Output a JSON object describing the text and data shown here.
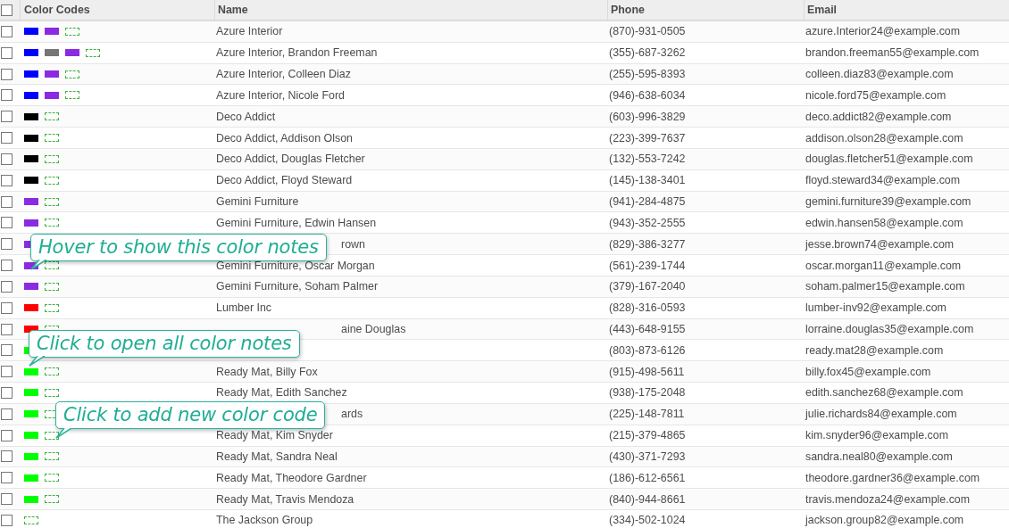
{
  "header": {
    "checked": false,
    "columns": [
      "Color Codes",
      "Name",
      "Phone",
      "Email"
    ]
  },
  "rows": [
    {
      "checked": false,
      "colors": [
        {
          "color": "#0000ff"
        },
        {
          "color": "#8a2be2"
        }
      ],
      "name": "Azure Interior",
      "phone": "(870)-931-0505",
      "email": "azure.Interior24@example.com"
    },
    {
      "checked": false,
      "colors": [
        {
          "color": "#0000ff"
        },
        {
          "color": "#757575"
        },
        {
          "color": "#8a2be2"
        }
      ],
      "name": "Azure Interior, Brandon Freeman",
      "phone": "(355)-687-3262",
      "email": "brandon.freeman55@example.com"
    },
    {
      "checked": false,
      "colors": [
        {
          "color": "#0000ff"
        },
        {
          "color": "#8a2be2"
        }
      ],
      "name": "Azure Interior, Colleen Diaz",
      "phone": "(255)-595-8393",
      "email": "colleen.diaz83@example.com"
    },
    {
      "checked": false,
      "colors": [
        {
          "color": "#0000ff"
        },
        {
          "color": "#8a2be2"
        }
      ],
      "name": "Azure Interior, Nicole Ford",
      "phone": "(946)-638-6034",
      "email": "nicole.ford75@example.com"
    },
    {
      "checked": false,
      "colors": [
        {
          "color": "#000000"
        }
      ],
      "name": "Deco Addict",
      "phone": "(603)-996-3829",
      "email": "deco.addict82@example.com"
    },
    {
      "checked": false,
      "colors": [
        {
          "color": "#000000"
        }
      ],
      "name": "Deco Addict, Addison Olson",
      "phone": "(223)-399-7637",
      "email": "addison.olson28@example.com"
    },
    {
      "checked": false,
      "colors": [
        {
          "color": "#000000"
        }
      ],
      "name": "Deco Addict, Douglas Fletcher",
      "phone": "(132)-553-7242",
      "email": "douglas.fletcher51@example.com"
    },
    {
      "checked": false,
      "colors": [
        {
          "color": "#000000"
        }
      ],
      "name": "Deco Addict, Floyd Steward",
      "phone": "(145)-138-3401",
      "email": "floyd.steward34@example.com"
    },
    {
      "checked": false,
      "colors": [
        {
          "color": "#8a2be2"
        }
      ],
      "name": "Gemini Furniture",
      "phone": "(941)-284-4875",
      "email": "gemini.furniture39@example.com"
    },
    {
      "checked": false,
      "colors": [
        {
          "color": "#8a2be2"
        }
      ],
      "name": "Gemini Furniture, Edwin Hansen",
      "phone": "(943)-352-2555",
      "email": "edwin.hansen58@example.com"
    },
    {
      "checked": false,
      "colors": [
        {
          "color": "#8a2be2"
        }
      ],
      "name": "rown",
      "name_cut": true,
      "add_covered": true,
      "phone": "(829)-386-3277",
      "email": "jesse.brown74@example.com"
    },
    {
      "checked": false,
      "colors": [
        {
          "color": "#8a2be2"
        }
      ],
      "name": "Gemini Furniture, Oscar Morgan",
      "phone": "(561)-239-1744",
      "email": "oscar.morgan11@example.com",
      "callout": {
        "kind": "hover",
        "text": "Hover to show this color notes"
      }
    },
    {
      "checked": false,
      "colors": [
        {
          "color": "#8a2be2"
        }
      ],
      "name": "Gemini Furniture, Soham Palmer",
      "phone": "(379)-167-2040",
      "email": "soham.palmer15@example.com"
    },
    {
      "checked": false,
      "colors": [
        {
          "color": "#ff0000"
        }
      ],
      "name": "Lumber Inc",
      "phone": "(828)-316-0593",
      "email": "lumber-inv92@example.com"
    },
    {
      "checked": false,
      "colors": [
        {
          "color": "#ff0000"
        }
      ],
      "name": "aine Douglas",
      "name_cut": true,
      "phone": "(443)-648-9155",
      "email": "lorraine.douglas35@example.com"
    },
    {
      "checked": false,
      "colors": [
        {
          "color": "#00ff00"
        }
      ],
      "add_covered": true,
      "phone": "(803)-873-6126",
      "email": "ready.mat28@example.com"
    },
    {
      "checked": false,
      "colors": [
        {
          "color": "#00ff00"
        }
      ],
      "name": "Ready Mat, Billy Fox",
      "phone": "(915)-498-5611",
      "email": "billy.fox45@example.com",
      "callout": {
        "kind": "open",
        "text": "Click to open all color notes"
      }
    },
    {
      "checked": false,
      "colors": [
        {
          "color": "#00ff00"
        }
      ],
      "name": "Ready Mat, Edith Sanchez",
      "phone": "(938)-175-2048",
      "email": "edith.sanchez68@example.com"
    },
    {
      "checked": false,
      "colors": [
        {
          "color": "#00ff00"
        }
      ],
      "name": "ards",
      "name_cut": true,
      "phone": "(225)-148-7811",
      "email": "julie.richards84@example.com"
    },
    {
      "checked": false,
      "colors": [
        {
          "color": "#00ff00"
        }
      ],
      "name": "Ready Mat, Kim Snyder",
      "phone": "(215)-379-4865",
      "email": "kim.snyder96@example.com",
      "callout": {
        "kind": "add",
        "text": "Click to add new color code"
      }
    },
    {
      "checked": false,
      "colors": [
        {
          "color": "#00ff00"
        }
      ],
      "name": "Ready Mat, Sandra Neal",
      "phone": "(430)-371-7293",
      "email": "sandra.neal80@example.com"
    },
    {
      "checked": false,
      "colors": [
        {
          "color": "#00ff00"
        }
      ],
      "name": "Ready Mat, Theodore Gardner",
      "phone": "(186)-612-6561",
      "email": "theodore.gardner36@example.com"
    },
    {
      "checked": false,
      "colors": [
        {
          "color": "#00ff00"
        }
      ],
      "name": "Ready Mat, Travis Mendoza",
      "phone": "(840)-944-8661",
      "email": "travis.mendoza24@example.com"
    },
    {
      "checked": false,
      "colors": [],
      "name": "The Jackson Group",
      "phone": "(334)-502-1024",
      "email": "jackson.group82@example.com"
    }
  ]
}
